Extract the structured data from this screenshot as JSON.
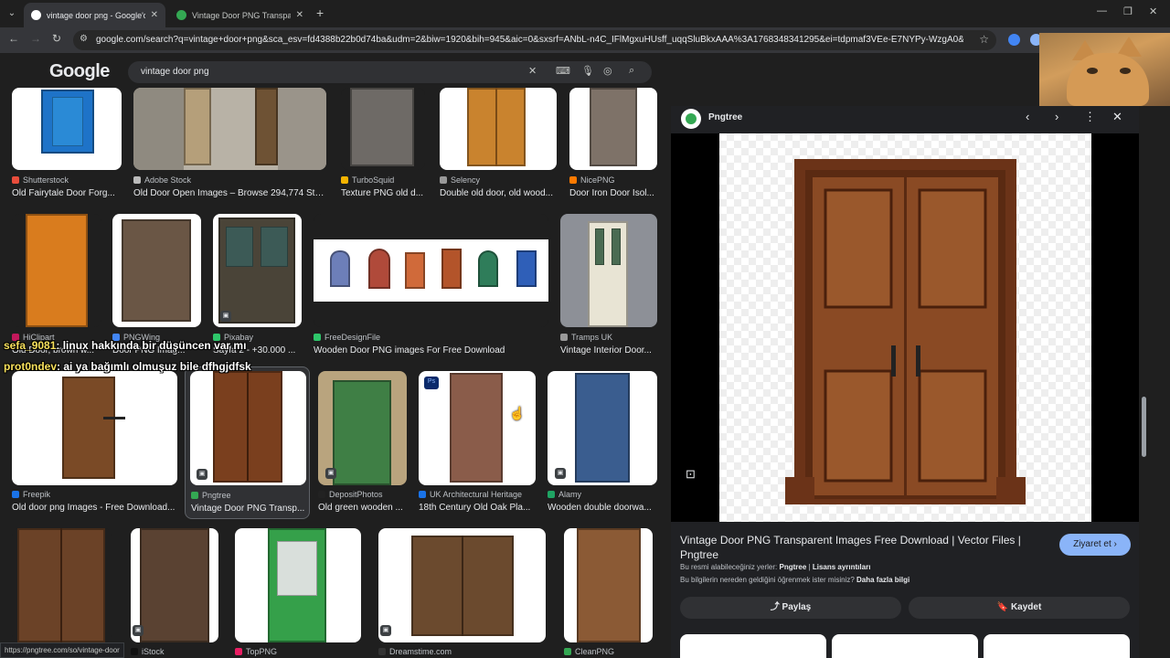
{
  "browser": {
    "tabs": [
      {
        "title": "vintage door png - Google'da A",
        "active": true
      },
      {
        "title": "Vintage Door PNG Transparent",
        "active": false
      }
    ],
    "url": "google.com/search?q=vintage+door+png&sca_esv=fd4388b22b0d74ba&udm=2&biw=1920&bih=945&aic=0&sxsrf=ANbL-n4C_IFlMgxuHUsff_uqqSluBkxAAA%3A1768348341295&ei=tdpmaf3VEe-E7NYPy-WzgA0&ved=0ahUKEwi...",
    "status_url": "https://pngtree.com/so/vintage-door"
  },
  "google": {
    "logo": "Google",
    "query": "vintage door png"
  },
  "results": [
    {
      "source": "Shutterstock",
      "title": "Old Fairytale Door Forg...",
      "color": "#1e73c8"
    },
    {
      "source": "Adobe Stock",
      "title": "Old Door Open Images – Browse 294,774 Sto...",
      "color": "#8a6b4a"
    },
    {
      "source": "TurboSquid",
      "title": "Texture PNG old d...",
      "color": "#6e6a66"
    },
    {
      "source": "Selency",
      "title": "Double old door, old wood...",
      "color": "#c9832e"
    },
    {
      "source": "NicePNG",
      "title": "Door Iron Door Isol...",
      "color": "#7e7268"
    },
    {
      "source": "HiClipart",
      "title": "Old Door, brown w...",
      "color": "#d97c1e"
    },
    {
      "source": "PNGWing",
      "title": "Door PNG Imag...",
      "color": "#6a5645"
    },
    {
      "source": "Pixabay",
      "title": "Sayfa 2 - +30.000 ...",
      "color": "#4a4438"
    },
    {
      "source": "FreeDesignFile",
      "title": "Wooden Door PNG images For Free Download",
      "color": "#ffffff"
    },
    {
      "source": "Tramps UK",
      "title": "Vintage Interior Door...",
      "color": "#e8e4d4"
    },
    {
      "source": "Freepik",
      "title": "Old door png Images - Free Download...",
      "color": "#7a4a26"
    },
    {
      "source": "Pngtree",
      "title": "Vintage Door PNG Transp...",
      "color": "#7a3f1e"
    },
    {
      "source": "DepositPhotos",
      "title": "Old green wooden ...",
      "color": "#3f7f45"
    },
    {
      "source": "UK Architectural Heritage",
      "title": "18th Century Old Oak Pla...",
      "color": "#8a5c4a"
    },
    {
      "source": "Alamy",
      "title": "Wooden double doorwa...",
      "color": "#3a5d8f"
    },
    {
      "source": "iStock",
      "title": "",
      "color": "#6b4227"
    },
    {
      "source": "TopPNG",
      "title": "",
      "color": "#35a04a"
    },
    {
      "source": "Dreamstime.com",
      "title": "",
      "color": "#6b4a2e"
    },
    {
      "source": "CleanPNG",
      "title": "",
      "color": "#8b5a35"
    }
  ],
  "ps_badge": "Ps",
  "chat": [
    {
      "user": "sefa_9081",
      "message": ": linux hakkında bir düşüncen var mı"
    },
    {
      "user": "prot0ndev",
      "message": ": ai ya bağımlı olmuşuz bile dfhgjdfsk"
    }
  ],
  "panel": {
    "site": "Pngtree",
    "title": "Vintage Door PNG Transparent Images Free Download | Vector Files | Pngtree",
    "visit_label": "Ziyaret et",
    "license_prefix": "Bu resmi alabileceğiniz yerler:",
    "license_site": "Pngtree",
    "license_link": "Lisans ayrıntıları",
    "info_text": "Bu bilgilerin nereden geldiğini öğrenmek ister misiniz?",
    "info_link": "Daha fazla bilgi",
    "share_label": "Paylaş",
    "save_label": "Kaydet",
    "door_color": "#7a3f1e"
  }
}
